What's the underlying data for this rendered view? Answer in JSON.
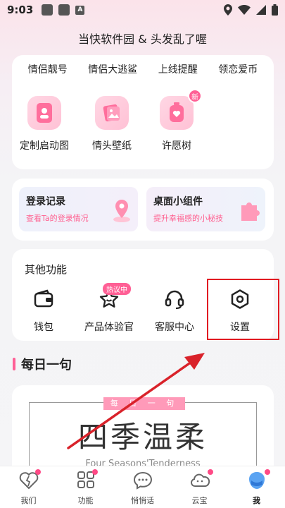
{
  "status_bar": {
    "time": "9:03",
    "notif_letter": "A"
  },
  "header": {
    "title": "当快软件园 & 头发乱了喔"
  },
  "top_tabs": [
    "情侣靓号",
    "情侣大逃鲨",
    "上线提醒",
    "领恋爱币"
  ],
  "features": [
    {
      "label": "定制启动图",
      "icon": "phone-portrait-icon"
    },
    {
      "label": "情头壁纸",
      "icon": "wallpaper-icon"
    },
    {
      "label": "许愿树",
      "icon": "wish-bottle-icon",
      "badge": "新"
    }
  ],
  "mini_cards": [
    {
      "title": "登录记录",
      "subtitle": "查看Ta的登录情况",
      "icon": "location-pin-icon"
    },
    {
      "title": "桌面小组件",
      "subtitle": "提升幸福感的小秘技",
      "icon": "puzzle-icon"
    }
  ],
  "other": {
    "title": "其他功能",
    "items": [
      {
        "label": "钱包",
        "icon": "wallet-icon"
      },
      {
        "label": "产品体验官",
        "icon": "star-face-icon",
        "badge": "热议中"
      },
      {
        "label": "客服中心",
        "icon": "headset-icon"
      },
      {
        "label": "设置",
        "icon": "settings-icon"
      }
    ]
  },
  "daily": {
    "title": "每日一句",
    "tag": "每 日 一 句",
    "quote_cn": "四季温柔",
    "quote_en": "Four Seasons'Tenderness"
  },
  "nav": [
    {
      "label": "我们",
      "icon": "heart-icon"
    },
    {
      "label": "功能",
      "icon": "grid-icon"
    },
    {
      "label": "悄悄话",
      "icon": "chat-icon"
    },
    {
      "label": "云宝",
      "icon": "cloud-icon"
    },
    {
      "label": "我",
      "icon": "profile-icon",
      "active": true
    }
  ],
  "colors": {
    "accent": "#ff5f95",
    "highlight": "#e11b22"
  }
}
